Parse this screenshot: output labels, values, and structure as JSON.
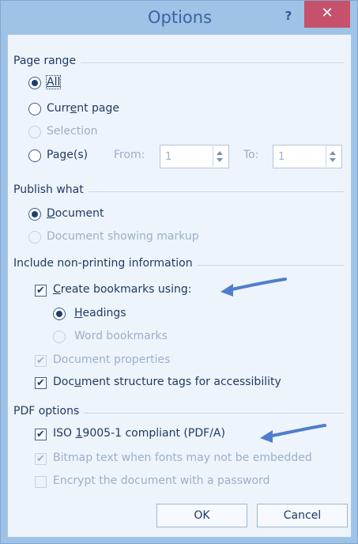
{
  "window": {
    "title": "Options",
    "help": "?",
    "close": "✕"
  },
  "page_range": {
    "title": "Page range",
    "all": {
      "pre": "",
      "u": "All",
      "post": ""
    },
    "current": {
      "pre": "Curr",
      "u": "e",
      "post": "nt page"
    },
    "selection": "Selection",
    "pages": {
      "pre": "Pa",
      "u": "g",
      "post": "e(s)"
    },
    "from_label": "From:",
    "from_value": "1",
    "to_label": "To:",
    "to_value": "1"
  },
  "publish_what": {
    "title": "Publish what",
    "document": {
      "pre": "",
      "u": "D",
      "post": "ocument"
    },
    "markup": "Document showing markup"
  },
  "nonprinting": {
    "title": "Include non-printing information",
    "bookmarks": {
      "pre": "",
      "u": "C",
      "post": "reate bookmarks using:"
    },
    "headings": {
      "pre": "",
      "u": "H",
      "post": "eadings"
    },
    "word_bookmarks": "Word bookmarks",
    "doc_properties": "Document properties",
    "structure_tags": {
      "pre": "Doc",
      "u": "u",
      "post": "ment structure tags for accessibility"
    }
  },
  "pdf_options": {
    "title": "PDF options",
    "iso": {
      "pre": "ISO ",
      "u": "1",
      "post": "9005-1 compliant (PDF/A)"
    },
    "bitmap": "Bitmap text when fonts may not be embedded",
    "encrypt": "Encrypt the document with a password"
  },
  "buttons": {
    "ok": "OK",
    "cancel": "Cancel"
  },
  "checkmark": "✔",
  "colors": {
    "accent": "#4f7ecb",
    "close": "#c7506a",
    "frame": "#9fc3e6"
  }
}
